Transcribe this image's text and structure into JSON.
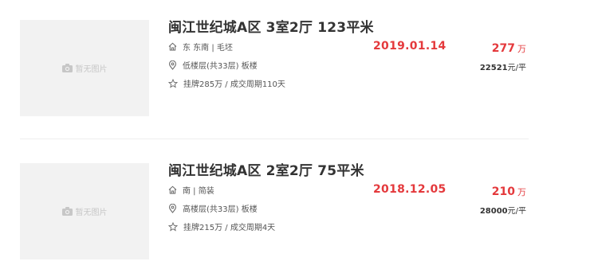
{
  "listings": [
    {
      "thumb_text": "暂无图片",
      "title": "闽江世纪城A区 3室2厅 123平米",
      "orientation": "东 东南 | 毛坯",
      "floor": "低楼层(共33层) 板楼",
      "deal": "挂牌285万 / 成交周期110天",
      "date": "2019.01.14",
      "price": "277",
      "price_unit": "万",
      "unit_price": "22521",
      "unit_price_suffix": "元/平"
    },
    {
      "thumb_text": "暂无图片",
      "title": "闽江世纪城A区 2室2厅 75平米",
      "orientation": "南 | 简装",
      "floor": "高楼层(共33层) 板楼",
      "deal": "挂牌215万 / 成交周期4天",
      "date": "2018.12.05",
      "price": "210",
      "price_unit": "万",
      "unit_price": "28000",
      "unit_price_suffix": "元/平"
    }
  ],
  "colors": {
    "accent": "#e4393c",
    "text": "#333333",
    "muted": "#555555",
    "placeholder_bg": "#f2f2f2"
  },
  "icons": [
    "camera-icon",
    "house-icon",
    "location-pin-icon",
    "star-icon"
  ]
}
